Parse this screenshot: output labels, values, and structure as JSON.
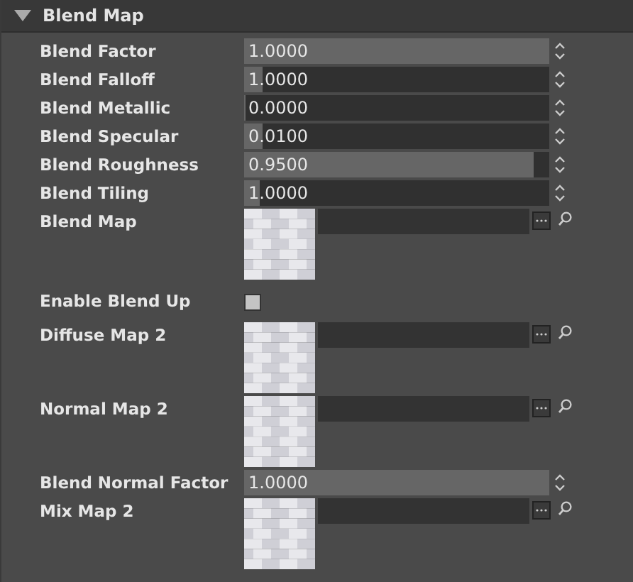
{
  "panel": {
    "title": "Blend Map",
    "expanded": true
  },
  "rows": [
    {
      "kind": "slider",
      "label": "Blend Factor",
      "value": "1.0000",
      "level": 1
    },
    {
      "kind": "slider",
      "label": "Blend Falloff",
      "value": "1.0000",
      "level": 0.06
    },
    {
      "kind": "slider",
      "label": "Blend Metallic",
      "value": "0.0000",
      "level": 0
    },
    {
      "kind": "slider",
      "label": "Blend Specular",
      "value": "0.0100",
      "level": 0.06
    },
    {
      "kind": "slider",
      "label": "Blend Roughness",
      "value": "0.9500",
      "level": 0.95
    },
    {
      "kind": "slider",
      "label": "Blend Tiling",
      "value": "1.0000",
      "level": 0.05
    },
    {
      "kind": "texture",
      "label": "Blend Map"
    },
    {
      "kind": "checkbox",
      "label": "Enable Blend Up",
      "checked": false
    },
    {
      "kind": "texture",
      "label": "Diffuse Map 2"
    },
    {
      "kind": "texture",
      "label": "Normal Map 2"
    },
    {
      "kind": "slider",
      "label": "Blend Normal Factor",
      "value": "1.0000",
      "level": 1
    },
    {
      "kind": "texture",
      "label": "Mix Map 2"
    }
  ]
}
